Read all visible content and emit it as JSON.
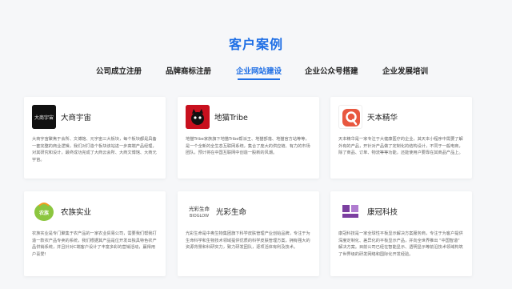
{
  "page": {
    "title": "客户案例"
  },
  "tabs": [
    {
      "label": "公司成立注册",
      "active": false
    },
    {
      "label": "品牌商标注册",
      "active": false
    },
    {
      "label": "企业网站建设",
      "active": true
    },
    {
      "label": "企业公众号搭建",
      "active": false
    },
    {
      "label": "企业发展培训",
      "active": false
    }
  ],
  "colors": {
    "accent": "#1f6fe5",
    "background": "#f6f7f9"
  },
  "cases": [
    {
      "name": "大商宇宙",
      "logo_icon": "dashangyuzhou-logo",
      "logo_text": "大商宇宙",
      "desc": "大商宇宙聚焦于会所、文博馆、元宇宙三大板块，每个板块都是具备一套完整的商业逻辑，我们对打造个板块该站进一步高端产品经理，对其研究和设计，最终成功完成了大商云会所、大商文博馆、大商元宇宙。"
    },
    {
      "name": "地猫Tribe",
      "logo_icon": "dimao-tribe-logo",
      "logo_text": "",
      "desc": "地猫Tribe家族旗下地猫Tribe帮派王、地猫部落、地猫官方站等等，是一个全新的全生态互联网系统，集合了庞大的供应链、有力的市场团队，预计将在中国互联网中创造一股新的风潮。"
    },
    {
      "name": "天本精华",
      "logo_icon": "tianben-jinghua-logo",
      "logo_text": "",
      "desc": "天本精华是一家专注于大健康医疗的企业，其天本小程序中需要了解外有的产品，开针对产品做了定制化的结构设计，不同于一般电商，除了商品、订单、物流等等功能，还能使用户要靠在其商品产品上。"
    },
    {
      "name": "农族实业",
      "logo_icon": "nongzu-shiye-logo",
      "logo_text": "农族",
      "desc": "农族实业是专门聚集于农产品的一家农业贸易公司，需要我们帮我打造一款农产品专卖的系统，我们根据其产品是位开发出独具特色农产品供销系统，并且针对C端客户设计了丰富多彩的营销活动，赢得用户喜爱!"
    },
    {
      "name": "光彩生命",
      "logo_icon": "guangcai-shengming-logo",
      "logo_text": "光彩生命",
      "logo_subtext": "BIOGLOW",
      "desc": "光彩生命是中奥生物集团旗下科学皮肤管理产业创始品牌，专注于为生命科学和生物技术领域提供优质的科学皮肤管理方案，拥有强大的资源背景和科研实力，致力研发团队，逐项活体有利及技术。"
    },
    {
      "name": "康冠科技",
      "logo_icon": "kangguan-keji-logo",
      "logo_text": "",
      "desc": "康冠科技是一家全球性平板显示解决方案服务商，专注于为客户提供深度定制化、差异化的平板显示产品，并向全世界推出 \"中国智造\" 解决方案。目前公司已经在智能显示、透明显示等前沿技术领域构筑了世界级的研发网络和国际化开发经验。"
    }
  ]
}
